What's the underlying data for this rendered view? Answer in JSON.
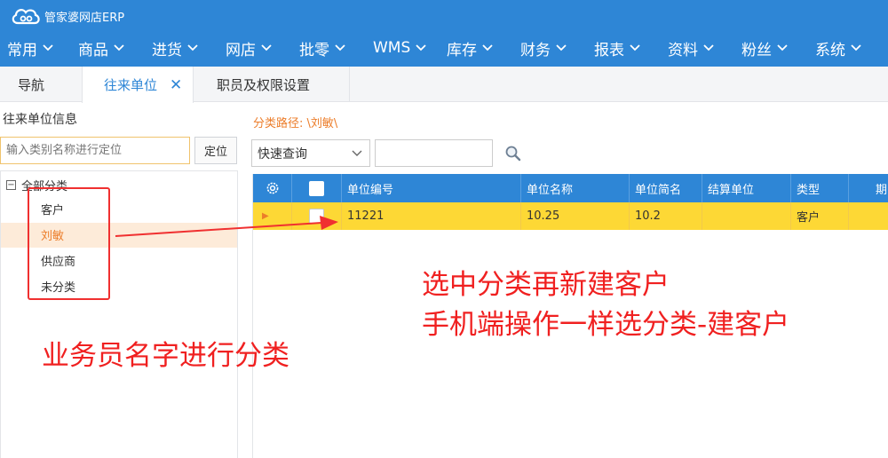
{
  "app": {
    "logo_text": "管家婆网店ERP"
  },
  "menu": [
    "常用",
    "商品",
    "进货",
    "网店",
    "批零",
    "WMS",
    "库存",
    "财务",
    "报表",
    "资料",
    "粉丝",
    "系统"
  ],
  "tabs": {
    "nav": "导航",
    "active": "往来单位",
    "perm": "职员及权限设置"
  },
  "left": {
    "title": "往来单位信息",
    "locate_placeholder": "输入类别名称进行定位",
    "locate_button": "定位",
    "tree": {
      "root": "全部分类",
      "items": [
        "客户",
        "刘敏",
        "供应商",
        "未分类"
      ],
      "selected_index": 1
    }
  },
  "right": {
    "path": "分类路径:  \\刘敏\\",
    "quick_query": "快速查询",
    "query_value": ""
  },
  "grid": {
    "columns": [
      "单位编号",
      "单位名称",
      "单位简名",
      "结算单位",
      "类型",
      "期"
    ],
    "rows": [
      {
        "code": "11221",
        "name": "10.25",
        "short": "10.2",
        "settle": "",
        "type": "客户",
        "period": ""
      }
    ]
  },
  "annotations": {
    "left_note": "业务员名字进行分类",
    "right_line1": "选中分类再新建客户",
    "right_line2": "手机端操作一样选分类-建客户"
  },
  "colors": {
    "header": "#2e86d6",
    "selected_row": "#fdd835",
    "accent": "#ec7d2a",
    "annotation": "#f02020"
  }
}
